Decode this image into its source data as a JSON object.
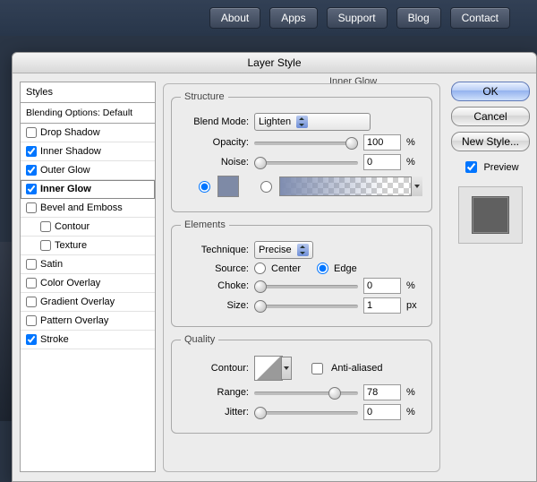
{
  "nav": {
    "items": [
      "About",
      "Apps",
      "Support",
      "Blog",
      "Contact"
    ]
  },
  "dialog": {
    "title": "Layer Style"
  },
  "styles": {
    "header": "Styles",
    "subheader": "Blending Options: Default",
    "items": [
      {
        "label": "Drop Shadow",
        "checked": false,
        "indent": 0
      },
      {
        "label": "Inner Shadow",
        "checked": true,
        "indent": 0
      },
      {
        "label": "Outer Glow",
        "checked": true,
        "indent": 0
      },
      {
        "label": "Inner Glow",
        "checked": true,
        "indent": 0,
        "selected": true
      },
      {
        "label": "Bevel and Emboss",
        "checked": false,
        "indent": 0
      },
      {
        "label": "Contour",
        "checked": false,
        "indent": 1
      },
      {
        "label": "Texture",
        "checked": false,
        "indent": 1
      },
      {
        "label": "Satin",
        "checked": false,
        "indent": 0
      },
      {
        "label": "Color Overlay",
        "checked": false,
        "indent": 0
      },
      {
        "label": "Gradient Overlay",
        "checked": false,
        "indent": 0
      },
      {
        "label": "Pattern Overlay",
        "checked": false,
        "indent": 0
      },
      {
        "label": "Stroke",
        "checked": true,
        "indent": 0
      }
    ]
  },
  "panel": {
    "title": "Inner Glow",
    "structure": {
      "legend": "Structure",
      "blend_label": "Blend Mode:",
      "blend_value": "Lighten",
      "opacity_label": "Opacity:",
      "opacity_value": "100",
      "opacity_unit": "%",
      "noise_label": "Noise:",
      "noise_value": "0",
      "noise_unit": "%",
      "color_selected": "solid",
      "swatch_color": "#7e8aa6"
    },
    "elements": {
      "legend": "Elements",
      "technique_label": "Technique:",
      "technique_value": "Precise",
      "source_label": "Source:",
      "source_center": "Center",
      "source_edge": "Edge",
      "source_value": "edge",
      "choke_label": "Choke:",
      "choke_value": "0",
      "choke_unit": "%",
      "size_label": "Size:",
      "size_value": "1",
      "size_unit": "px"
    },
    "quality": {
      "legend": "Quality",
      "contour_label": "Contour:",
      "aa_label": "Anti-aliased",
      "aa_checked": false,
      "range_label": "Range:",
      "range_value": "78",
      "range_unit": "%",
      "jitter_label": "Jitter:",
      "jitter_value": "0",
      "jitter_unit": "%"
    }
  },
  "buttons": {
    "ok": "OK",
    "cancel": "Cancel",
    "new_style": "New Style..."
  },
  "preview": {
    "label": "Preview",
    "checked": true
  }
}
